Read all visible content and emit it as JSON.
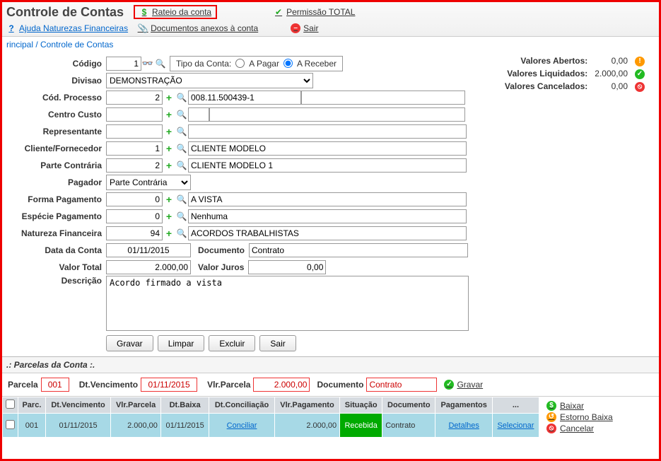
{
  "header": {
    "title": "Controle de Contas",
    "rateio": "Rateio da conta",
    "permissao": "Permissão TOTAL",
    "ajuda": "Ajuda Naturezas Financeiras",
    "anexos": "Documentos anexos à conta",
    "sair": "Sair"
  },
  "breadcrumb": "rincipal / Controle de Contas",
  "labels": {
    "codigo": "Código",
    "tipo": "Tipo da Conta:",
    "apagar": "A Pagar",
    "areceber": "A Receber",
    "divisao": "Divisao",
    "codprocesso": "Cód. Processo",
    "centrocusto": "Centro Custo",
    "representante": "Representante",
    "cliente": "Cliente/Fornecedor",
    "parte": "Parte Contrária",
    "pagador": "Pagador",
    "formapag": "Forma Pagamento",
    "especie": "Espécie Pagamento",
    "natureza": "Natureza Financeira",
    "dataconta": "Data da Conta",
    "documento": "Documento",
    "valortotal": "Valor Total",
    "valorjuros": "Valor Juros",
    "descricao": "Descrição"
  },
  "form": {
    "codigo": "1",
    "divisao": "DEMONSTRAÇÃO",
    "codprocesso": "2",
    "codprocesso_desc": "008.11.500439-1",
    "centrocusto": "",
    "centrocusto_desc": "",
    "representante": "",
    "representante_desc": "",
    "cliente": "1",
    "cliente_desc": "CLIENTE MODELO",
    "parte": "2",
    "parte_desc": "CLIENTE MODELO 1",
    "pagador": "Parte Contrária",
    "formapag": "0",
    "formapag_desc": "A VISTA",
    "especie": "0",
    "especie_desc": "Nenhuma",
    "natureza": "94",
    "natureza_desc": "ACORDOS TRABALHISTAS",
    "dataconta": "01/11/2015",
    "documento": "Contrato",
    "valortotal": "2.000,00",
    "valorjuros": "0,00",
    "descricao": "Acordo firmado a vista"
  },
  "totals": {
    "abertos_lbl": "Valores Abertos:",
    "abertos_val": "0,00",
    "liquidados_lbl": "Valores Liquidados:",
    "liquidados_val": "2.000,00",
    "cancelados_lbl": "Valores Cancelados:",
    "cancelados_val": "0,00"
  },
  "buttons": {
    "gravar": "Gravar",
    "limpar": "Limpar",
    "excluir": "Excluir",
    "sair": "Sair"
  },
  "parcelas": {
    "section": ".: Parcelas da Conta :.",
    "parcela_lbl": "Parcela",
    "parcela_val": "001",
    "venc_lbl": "Dt.Vencimento",
    "venc_val": "01/11/2015",
    "vlr_lbl": "Vlr.Parcela",
    "vlr_val": "2.000,00",
    "doc_lbl": "Documento",
    "doc_val": "Contrato",
    "gravar": "Gravar",
    "headers": {
      "parc": "Parc.",
      "venc": "Dt.Vencimento",
      "vlr": "Vlr.Parcela",
      "baixa": "Dt.Baixa",
      "concil": "Dt.Conciliação",
      "pag": "Vlr.Pagamento",
      "sit": "Situação",
      "doc": "Documento",
      "pagamentos": "Pagamentos",
      "extra": "..."
    },
    "row": {
      "parc": "001",
      "venc": "01/11/2015",
      "vlr": "2.000,00",
      "baixa": "01/11/2015",
      "concil": "Conciliar",
      "pag": "2.000,00",
      "sit": "Recebida",
      "doc": "Contrato",
      "pagamentos": "Detalhes",
      "selecionar": "Selecionar"
    }
  },
  "side": {
    "baixar": "Baixar",
    "estorno": "Estorno Baixa",
    "cancelar": "Cancelar"
  }
}
